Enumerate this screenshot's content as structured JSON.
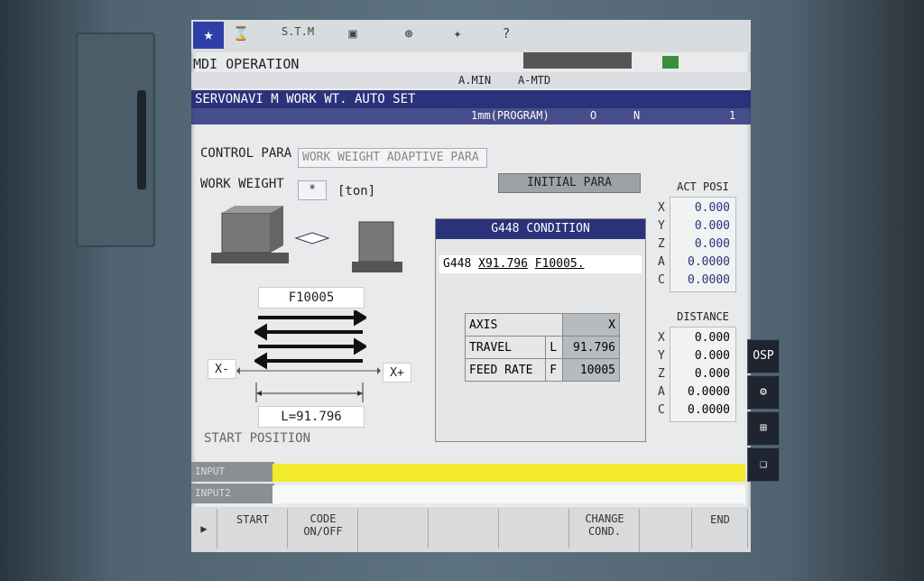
{
  "header": {
    "mode": "MDI OPERATION",
    "top_labels": [
      "S.T.M"
    ],
    "status_left": "A.MIN",
    "status_right": "A-MTD"
  },
  "title": {
    "text": "SERVONAVI M WORK WT. AUTO SET",
    "unit": "1mm(PROGRAM)",
    "o_label": "O",
    "n_label": "N",
    "n_value": "1"
  },
  "form": {
    "control_para_label": "CONTROL PARA",
    "control_para_value": "WORK WEIGHT ADAPTIVE PARA",
    "work_weight_label": "WORK WEIGHT",
    "work_weight_value": "*",
    "work_weight_unit": "[ton]",
    "initial_para_button": "INITIAL PARA"
  },
  "diagram": {
    "feed": "F10005",
    "x_minus": "X-",
    "x_plus": "X+",
    "length": "L=91.796",
    "start_position": "START POSITION"
  },
  "g448": {
    "header": "G448 CONDITION",
    "code": "G448",
    "code_x": "X91.796",
    "code_f": "F10005.",
    "table": {
      "rows": [
        {
          "name": "AXIS",
          "sym": "",
          "value": "X"
        },
        {
          "name": "TRAVEL",
          "sym": "L",
          "value": "91.796"
        },
        {
          "name": "FEED RATE",
          "sym": "F",
          "value": "10005"
        }
      ]
    }
  },
  "act_posi": {
    "header": "ACT POSI",
    "axes": [
      {
        "axis": "X",
        "value": "0.000"
      },
      {
        "axis": "Y",
        "value": "0.000"
      },
      {
        "axis": "Z",
        "value": "0.000"
      },
      {
        "axis": "A",
        "value": "0.0000"
      },
      {
        "axis": "C",
        "value": "0.0000"
      }
    ]
  },
  "distance": {
    "header": "DISTANCE",
    "axes": [
      {
        "axis": "X",
        "value": "0.000"
      },
      {
        "axis": "Y",
        "value": "0.000"
      },
      {
        "axis": "Z",
        "value": "0.000"
      },
      {
        "axis": "A",
        "value": "0.0000"
      },
      {
        "axis": "C",
        "value": "0.0000"
      }
    ]
  },
  "input": {
    "input_label": "INPUT",
    "second_label": "INPUT2",
    "input_color": "#f2ea2b"
  },
  "fkeys": {
    "start": "START",
    "code_onoff_1": "CODE",
    "code_onoff_2": "ON/OFF",
    "change_cond_1": "CHANGE",
    "change_cond_2": "COND.",
    "end": "END"
  },
  "side_tabs": {
    "osp": "OSP"
  },
  "colors": {
    "accent": "#2a327a",
    "screen_bg": "#e8eaec",
    "yellow": "#f2ea2b"
  }
}
